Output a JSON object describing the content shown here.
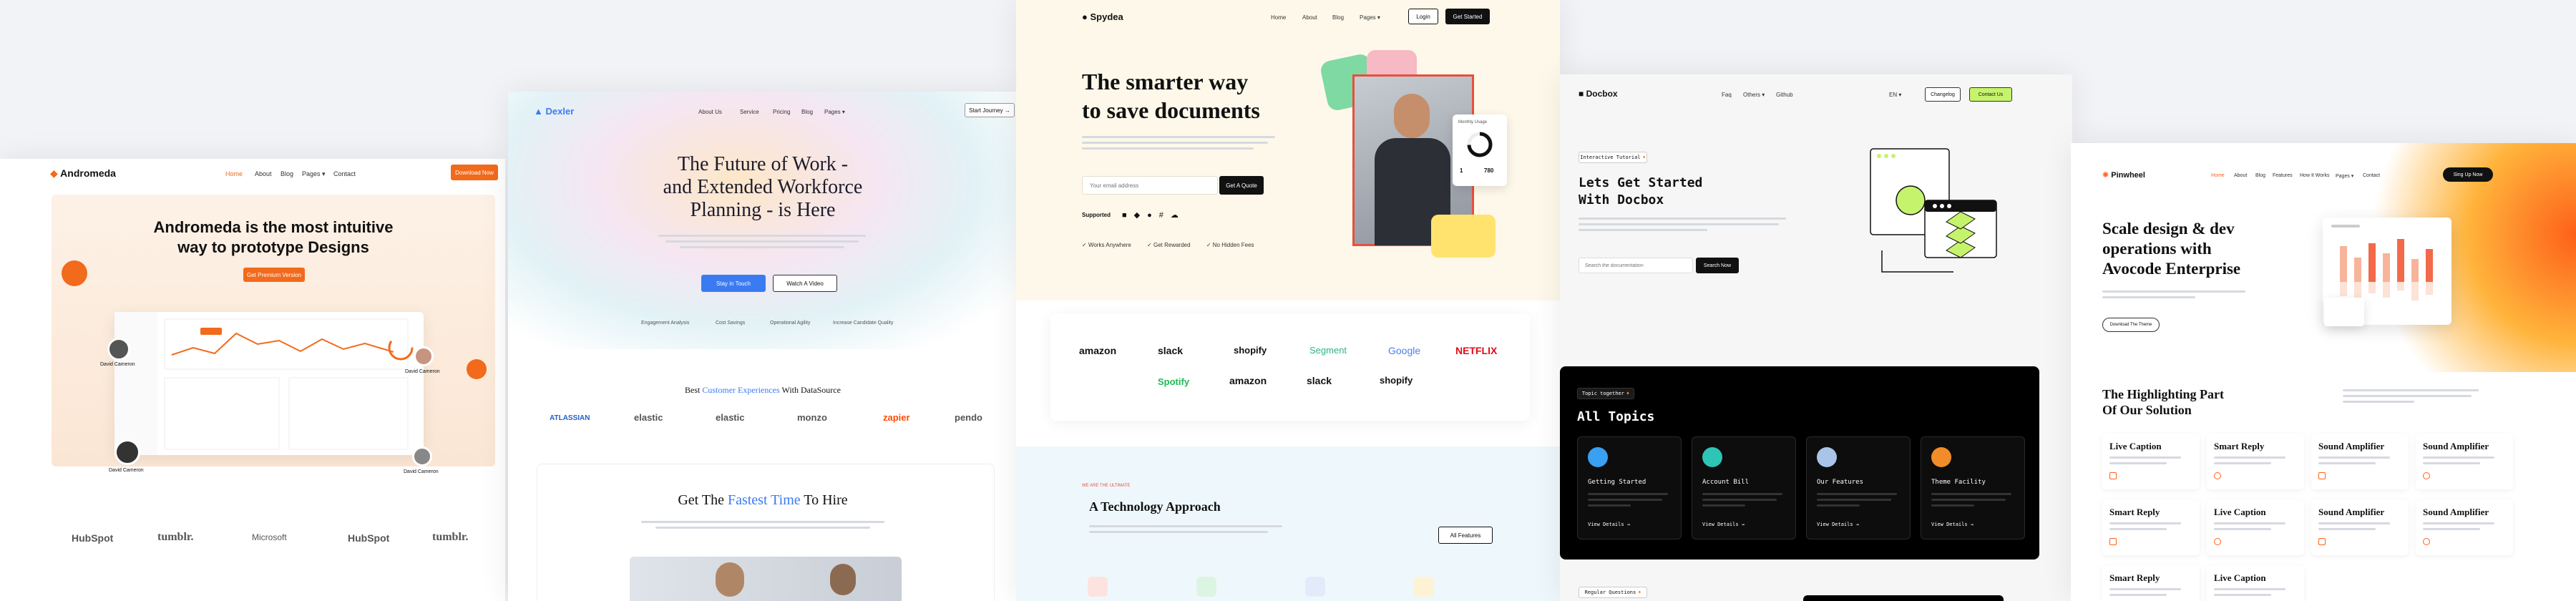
{
  "andromeda": {
    "brand": "Andromeda",
    "nav": [
      "Home",
      "About",
      "Blog",
      "Pages ▾",
      "Contact"
    ],
    "cta": "Download Now",
    "hero_title_1": "Andromeda is the most intuitive",
    "hero_title_2": "way to prototype Designs",
    "hero_button": "Get Premium Version",
    "avatar_names": [
      "David Cameron",
      "David Cameron",
      "David Cameron",
      "David Cameron"
    ],
    "logos": [
      "HubSpot",
      "tumblr.",
      "Microsoft",
      "HubSpot",
      "tumblr."
    ],
    "accent": "#f26a1b"
  },
  "dexler": {
    "brand": "Dexler",
    "nav": [
      "About Us",
      "Service",
      "Pricing",
      "Blog",
      "Pages ▾"
    ],
    "start": "Start Journey →",
    "hero_1": "The Future of Work -",
    "hero_2": "and Extended Workforce",
    "hero_3": "Planning - is Here",
    "btn_primary": "Stay in Touch",
    "btn_secondary": "Watch A Video",
    "features": [
      "Engagement Analysis",
      "Cost Savings",
      "Operational Agility",
      "Increase Candidate Quality"
    ],
    "customers_pre": "Best ",
    "customers_hl": "Customer Experiences",
    "customers_post": " With DataSource",
    "logos": [
      "ATLASSIAN",
      "elastic",
      "elastic",
      "monzo",
      "zapier",
      "pendo"
    ],
    "hire_pre": "Get The ",
    "hire_hl": "Fastest Time",
    "hire_post": " To Hire",
    "accent": "#3b7bf2"
  },
  "spydea": {
    "brand": "Spydea",
    "nav": [
      "Home",
      "About",
      "Blog",
      "Pages ▾"
    ],
    "login": "Login",
    "get_started": "Get Started",
    "hero_1": "The smarter way",
    "hero_2": "to save documents",
    "email_placeholder": "Your email address",
    "quote_btn": "Get A Quote",
    "supported": "Supported",
    "checks": [
      "Works Anywhere",
      "Get Rewarded",
      "No Hidden Fees"
    ],
    "stat_title": "Monthly Usage",
    "stat_a": "1",
    "stat_b": "780",
    "logos_row1": [
      "amazon",
      "slack",
      "shopify",
      "Segment",
      "Google",
      "NETFLIX"
    ],
    "logos_row2": [
      "Spotify",
      "amazon",
      "slack",
      "shopify"
    ],
    "tech_label": "WE ARE THE ULTIMATE",
    "tech_title": "A Technology Approach",
    "all_features": "All Features",
    "accent": "#111111"
  },
  "docbox": {
    "brand": "Docbox",
    "nav": [
      "Faq",
      "Others ▾",
      "Github"
    ],
    "lang": "EN ▾",
    "changelog": "Changelog",
    "contact": "Contact Us",
    "tag": "Interactive Tutorial",
    "hero_1": "Lets Get Started",
    "hero_2": "With Docbox",
    "search_placeholder": "Search the documentation",
    "search_btn": "Search Now",
    "topics_tag": "Topic together",
    "topics_title": "All Topics",
    "topics": [
      {
        "title": "Getting Started",
        "link": "View Details →",
        "color": "#3aa0f2"
      },
      {
        "title": "Account Bill",
        "link": "View Details →",
        "color": "#2ec4b6"
      },
      {
        "title": "Our Features",
        "link": "View Details →",
        "color": "#a9c4e8"
      },
      {
        "title": "Theme Facility",
        "link": "View Details →",
        "color": "#f28c2a"
      }
    ],
    "faq_tag": "Regular Questions",
    "accent": "#c6f36c"
  },
  "pinwheel": {
    "brand": "Pinwheel",
    "nav": [
      "Home",
      "About",
      "Blog",
      "Features",
      "How It Works",
      "Pages ▾",
      "Contact"
    ],
    "signup": "Sing Up Now",
    "hero_1": "Scale design & dev",
    "hero_2": "operations with",
    "hero_3": "Avocode Enterprise",
    "download": "Download The Theme",
    "section_1": "The Highlighting Part",
    "section_2": "Of Our Solution",
    "cards": [
      "Live Caption",
      "Smart Reply",
      "Sound Amplifier",
      "Sound Amplifier",
      "Smart Reply",
      "Live Caption",
      "Sound Amplifier",
      "Sound Amplifier",
      "Smart Reply",
      "Live Caption"
    ],
    "accent": "#fe6019"
  }
}
